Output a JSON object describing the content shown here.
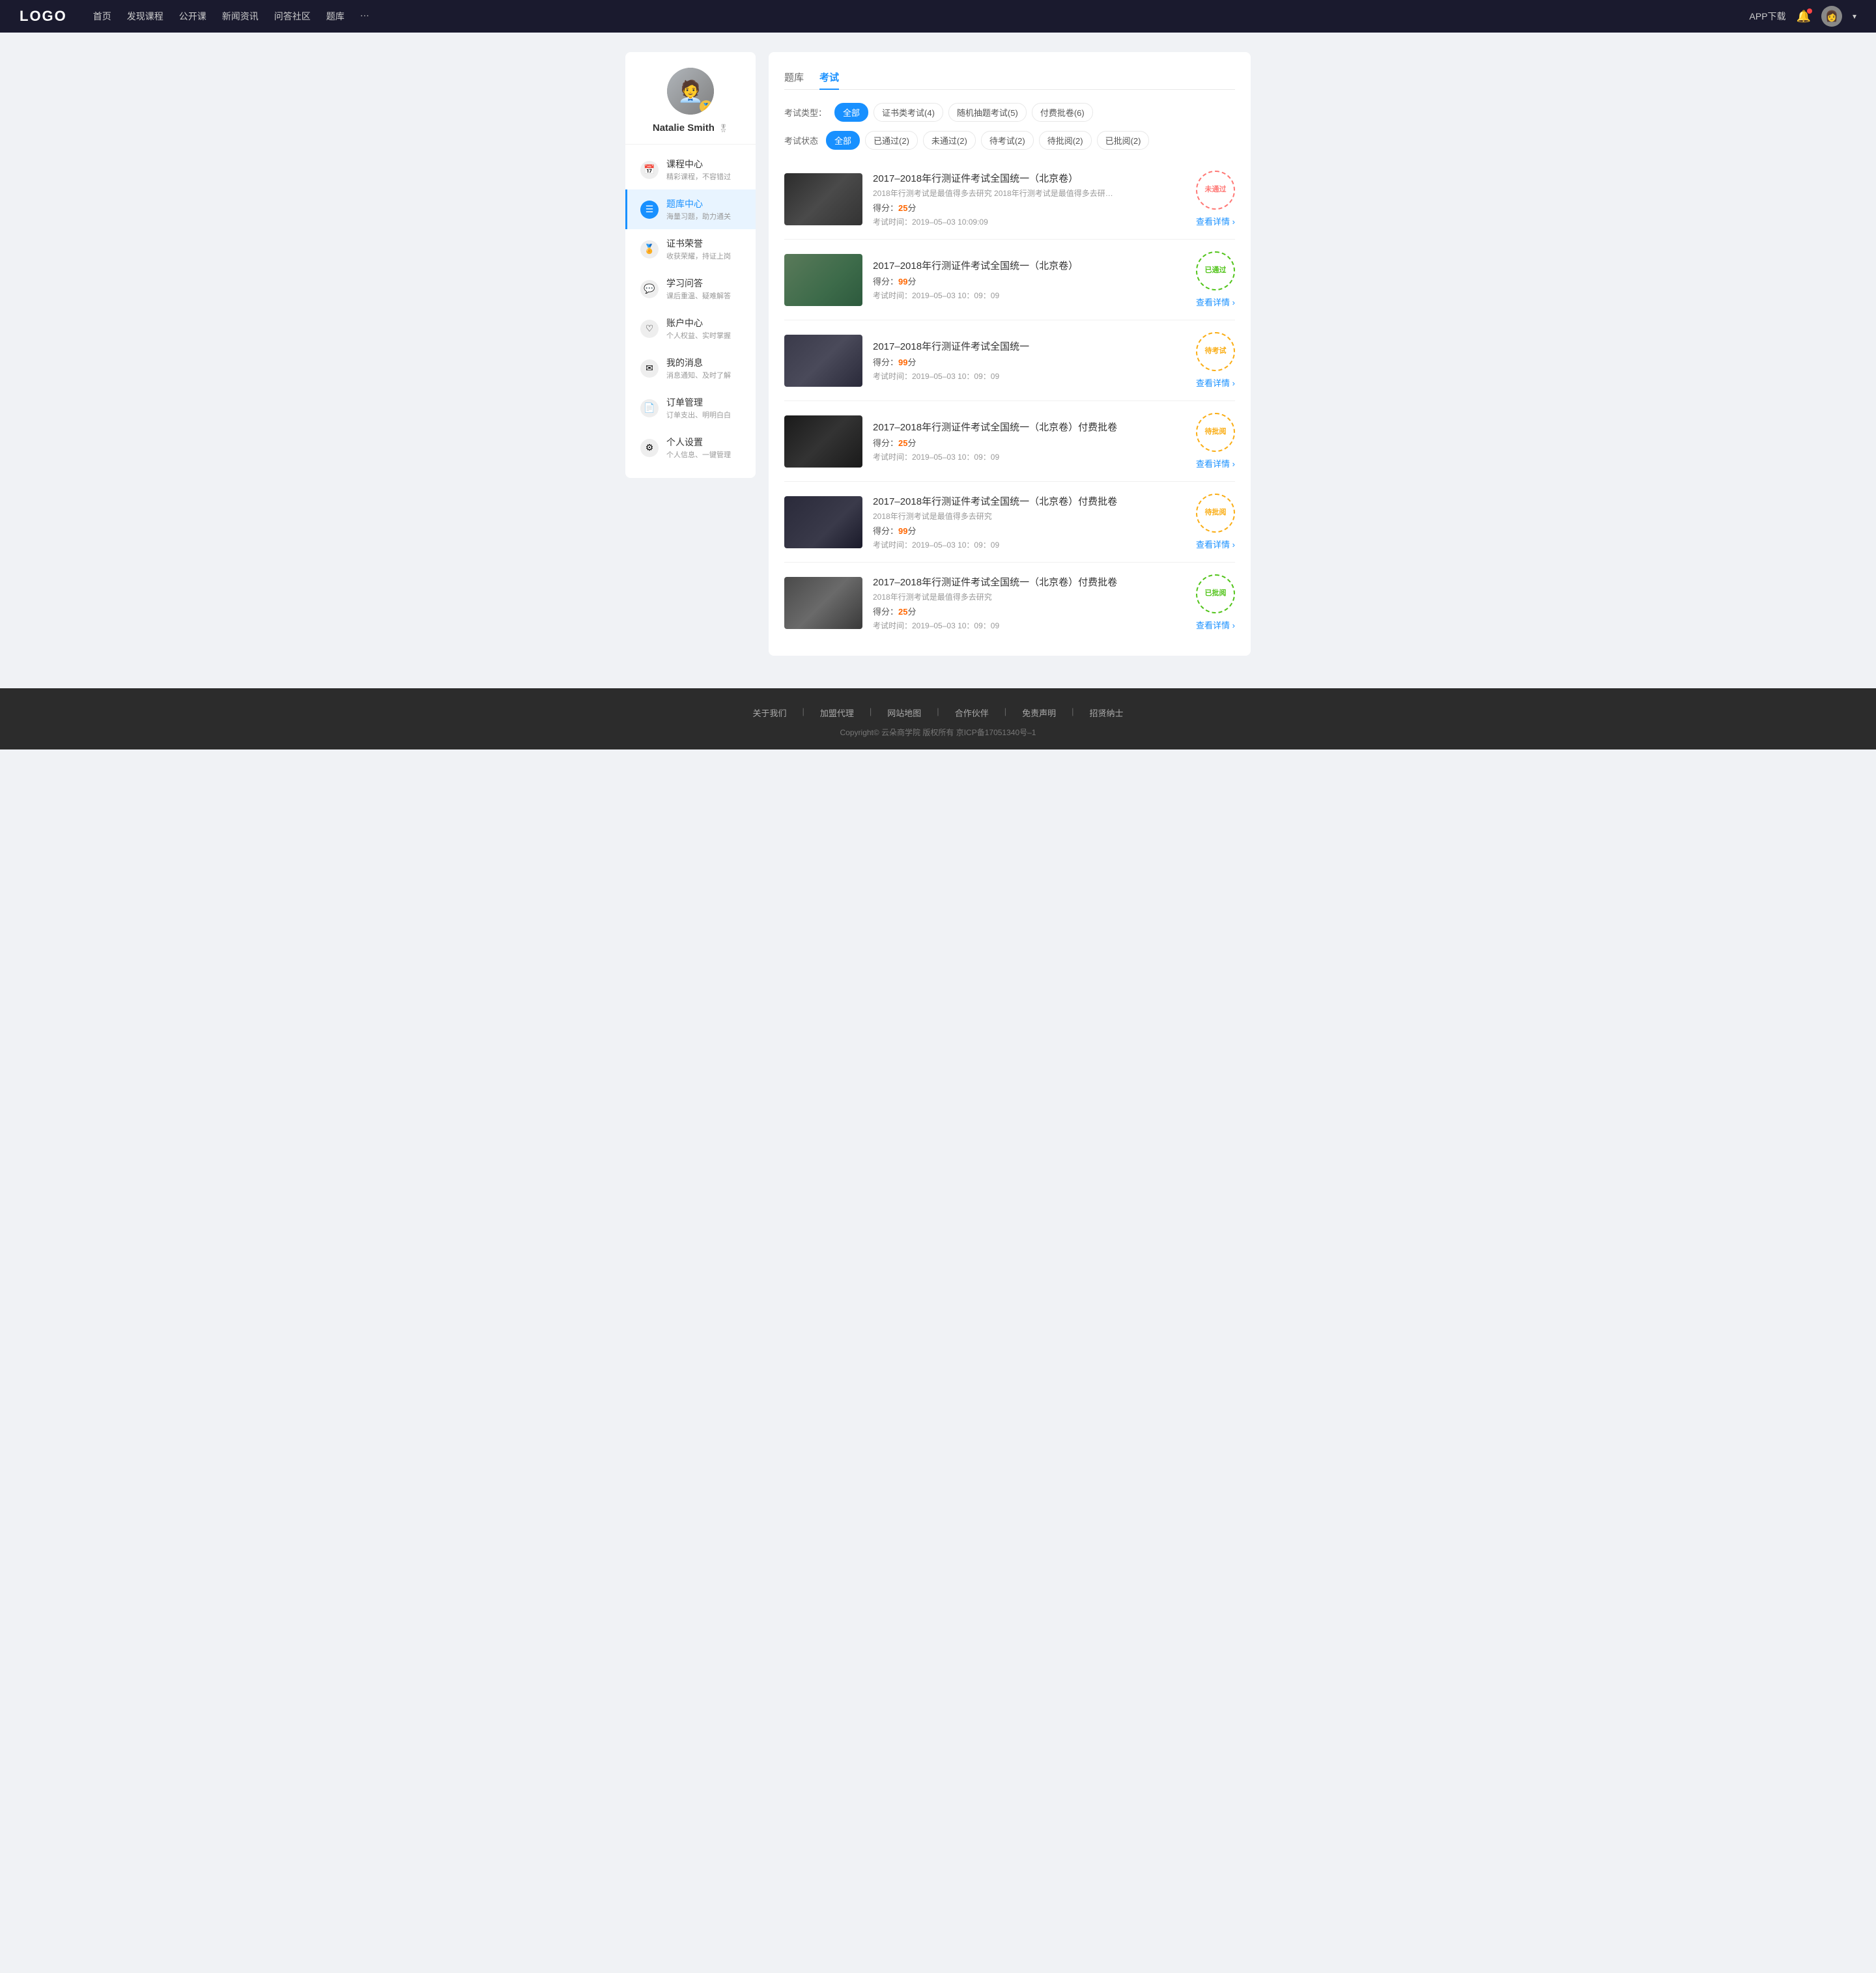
{
  "navbar": {
    "logo": "LOGO",
    "nav": [
      {
        "label": "首页",
        "id": "home"
      },
      {
        "label": "发现课程",
        "id": "discover"
      },
      {
        "label": "公开课",
        "id": "opencourse"
      },
      {
        "label": "新闻资讯",
        "id": "news"
      },
      {
        "label": "问答社区",
        "id": "qa"
      },
      {
        "label": "题库",
        "id": "qbank"
      },
      {
        "label": "···",
        "id": "more"
      }
    ],
    "app_download": "APP下载",
    "user_chevron": "▾"
  },
  "sidebar": {
    "user": {
      "name": "Natalie Smith",
      "vip_icon": "🎖"
    },
    "menu": [
      {
        "id": "course-center",
        "icon": "📅",
        "label": "课程中心",
        "sub": "精彩课程，不容错过",
        "active": false
      },
      {
        "id": "question-center",
        "icon": "☰",
        "label": "题库中心",
        "sub": "海量习题，助力通关",
        "active": true
      },
      {
        "id": "certificate",
        "icon": "🏅",
        "label": "证书荣誉",
        "sub": "收获荣耀，持证上岗",
        "active": false
      },
      {
        "id": "qa",
        "icon": "💬",
        "label": "学习问答",
        "sub": "课后重温、疑难解答",
        "active": false
      },
      {
        "id": "account",
        "icon": "♡",
        "label": "账户中心",
        "sub": "个人权益、实时掌握",
        "active": false
      },
      {
        "id": "messages",
        "icon": "✉",
        "label": "我的消息",
        "sub": "消息通知、及时了解",
        "active": false
      },
      {
        "id": "orders",
        "icon": "📄",
        "label": "订单管理",
        "sub": "订单支出、明明白白",
        "active": false
      },
      {
        "id": "settings",
        "icon": "⚙",
        "label": "个人设置",
        "sub": "个人信息、一键管理",
        "active": false
      }
    ]
  },
  "content": {
    "tabs": [
      {
        "label": "题库",
        "id": "qbank",
        "active": false
      },
      {
        "label": "考试",
        "id": "exam",
        "active": true
      }
    ],
    "filter_type": {
      "label": "考试类型：",
      "options": [
        {
          "label": "全部",
          "active": true
        },
        {
          "label": "证书类考试(4)",
          "active": false
        },
        {
          "label": "随机抽题考试(5)",
          "active": false
        },
        {
          "label": "付费批卷(6)",
          "active": false
        }
      ]
    },
    "filter_status": {
      "label": "考试状态",
      "options": [
        {
          "label": "全部",
          "active": true
        },
        {
          "label": "已通过(2)",
          "active": false
        },
        {
          "label": "未通过(2)",
          "active": false
        },
        {
          "label": "待考试(2)",
          "active": false
        },
        {
          "label": "待批阅(2)",
          "active": false
        },
        {
          "label": "已批阅(2)",
          "active": false
        }
      ]
    },
    "exams": [
      {
        "id": 1,
        "title": "2017–2018年行测证件考试全国统一（北京卷）",
        "desc": "2018年行测考试是最值得多去研究 2018年行测考试是最值得多去研究 2018年行...",
        "score": "25",
        "time": "考试时间：2019–05–03  10:09:09",
        "status": "未通过",
        "status_type": "fail",
        "detail": "查看详情",
        "thumb_class": "thumb-1"
      },
      {
        "id": 2,
        "title": "2017–2018年行测证件考试全国统一（北京卷）",
        "desc": "",
        "score": "99",
        "time": "考试时间：2019–05–03  10：09：09",
        "status": "已通过",
        "status_type": "pass",
        "detail": "查看详情",
        "thumb_class": "thumb-2"
      },
      {
        "id": 3,
        "title": "2017–2018年行测证件考试全国统一",
        "desc": "",
        "score": "99",
        "time": "考试时间：2019–05–03  10：09：09",
        "status": "待考试",
        "status_type": "pending",
        "detail": "查看详情",
        "thumb_class": "thumb-3"
      },
      {
        "id": 4,
        "title": "2017–2018年行测证件考试全国统一（北京卷）付费批卷",
        "desc": "",
        "score": "25",
        "time": "考试时间：2019–05–03  10：09：09",
        "status": "待批阅",
        "status_type": "review",
        "detail": "查看详情",
        "thumb_class": "thumb-4"
      },
      {
        "id": 5,
        "title": "2017–2018年行测证件考试全国统一（北京卷）付费批卷",
        "desc": "2018年行测考试是最值得多去研究",
        "score": "99",
        "time": "考试时间：2019–05–03  10：09：09",
        "status": "待批阅",
        "status_type": "review",
        "detail": "查看详情",
        "thumb_class": "thumb-5"
      },
      {
        "id": 6,
        "title": "2017–2018年行测证件考试全国统一（北京卷）付费批卷",
        "desc": "2018年行测考试是最值得多去研究",
        "score": "25",
        "time": "考试时间：2019–05–03  10：09：09",
        "status": "已批阅",
        "status_type": "reviewed",
        "detail": "查看详情",
        "thumb_class": "thumb-6"
      }
    ]
  },
  "footer": {
    "links": [
      {
        "label": "关于我们"
      },
      {
        "label": "加盟代理"
      },
      {
        "label": "网站地图"
      },
      {
        "label": "合作伙伴"
      },
      {
        "label": "免责声明"
      },
      {
        "label": "招贤纳士"
      }
    ],
    "copyright": "Copyright© 云朵商学院  版权所有    京ICP备17051340号–1"
  }
}
